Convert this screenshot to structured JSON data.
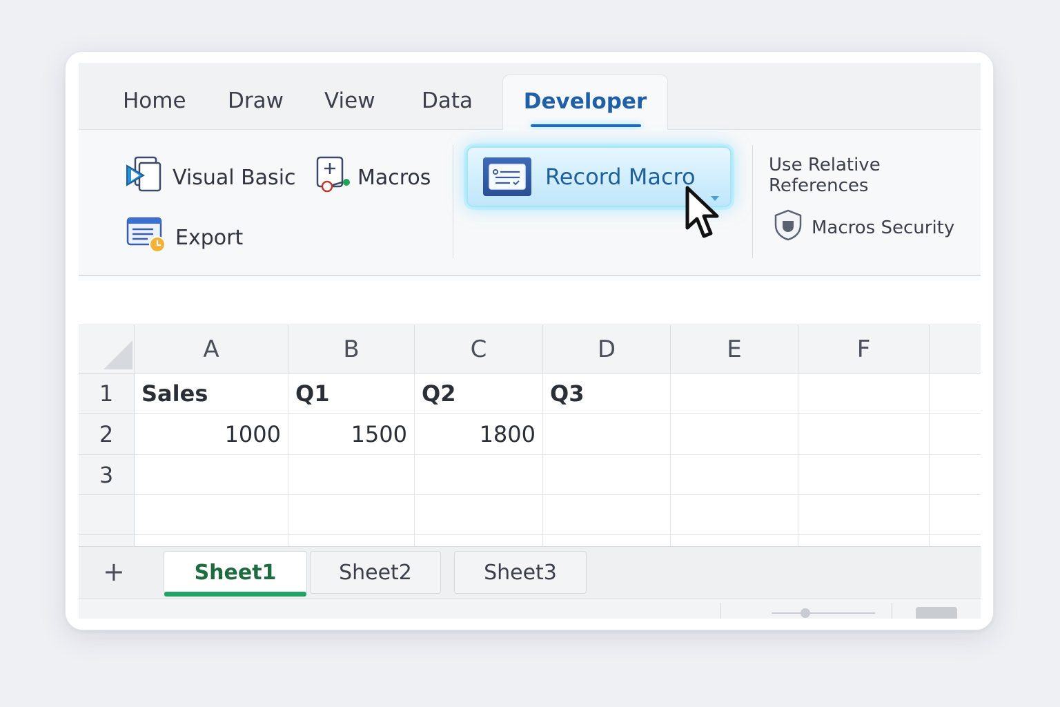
{
  "tabs": [
    {
      "label": "Home"
    },
    {
      "label": "Draw"
    },
    {
      "label": "View"
    },
    {
      "label": "Data"
    },
    {
      "label": "Developer"
    }
  ],
  "ribbon": {
    "visual_basic": "Visual Basic",
    "macros": "Macros",
    "export": "Export",
    "record_macro": "Record Macro",
    "use_relative_references": "Use Relative References",
    "macros_security": "Macros Security"
  },
  "columns": [
    "A",
    "B",
    "C",
    "D",
    "E",
    "F"
  ],
  "rows": [
    "1",
    "2",
    "3"
  ],
  "cells": {
    "A1": "Sales",
    "B1": "Q1",
    "C1": "Q2",
    "D1": "Q3",
    "A2": "1000",
    "B2": "1500",
    "C2": "1800"
  },
  "sheets": [
    "Sheet1",
    "Sheet2",
    "Sheet3"
  ],
  "add_sheet": "+",
  "colors": {
    "accent": "#1f6db8",
    "sheet_active": "#21a366",
    "record_glow": "#8cebff"
  }
}
